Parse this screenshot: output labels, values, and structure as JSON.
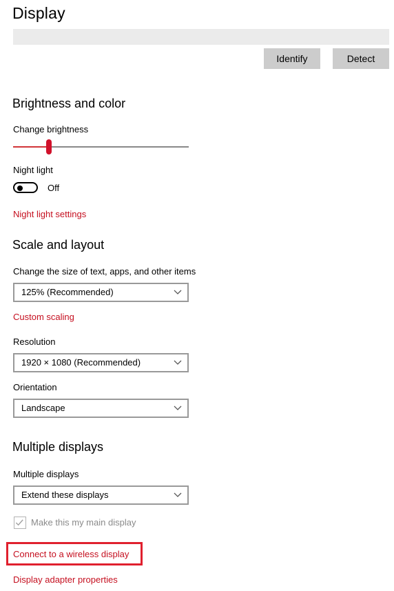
{
  "header": {
    "title": "Display",
    "identify_label": "Identify",
    "detect_label": "Detect"
  },
  "brightness": {
    "section_title": "Brightness and color",
    "change_label": "Change brightness",
    "slider_value_fraction": 0.2,
    "night_light_label": "Night light",
    "night_light_state": "Off",
    "night_light_settings_link": "Night light settings"
  },
  "scale": {
    "section_title": "Scale and layout",
    "size_label": "Change the size of text, apps, and other items",
    "size_value": "125% (Recommended)",
    "custom_scaling_link": "Custom scaling",
    "resolution_label": "Resolution",
    "resolution_value": "1920 × 1080 (Recommended)",
    "orientation_label": "Orientation",
    "orientation_value": "Landscape"
  },
  "multiple": {
    "section_title": "Multiple displays",
    "label": "Multiple displays",
    "value": "Extend these displays",
    "main_display_label": "Make this my main display",
    "wireless_link": "Connect to a wireless display",
    "adapter_link": "Display adapter properties"
  },
  "colors": {
    "accent_link": "#c50f1f",
    "slider_fill": "#d13438",
    "highlight_border": "#e0202e",
    "button_bg": "#cccccc"
  },
  "icons": {
    "dropdown": "chevron-down-icon",
    "checkbox": "checkmark-icon"
  }
}
